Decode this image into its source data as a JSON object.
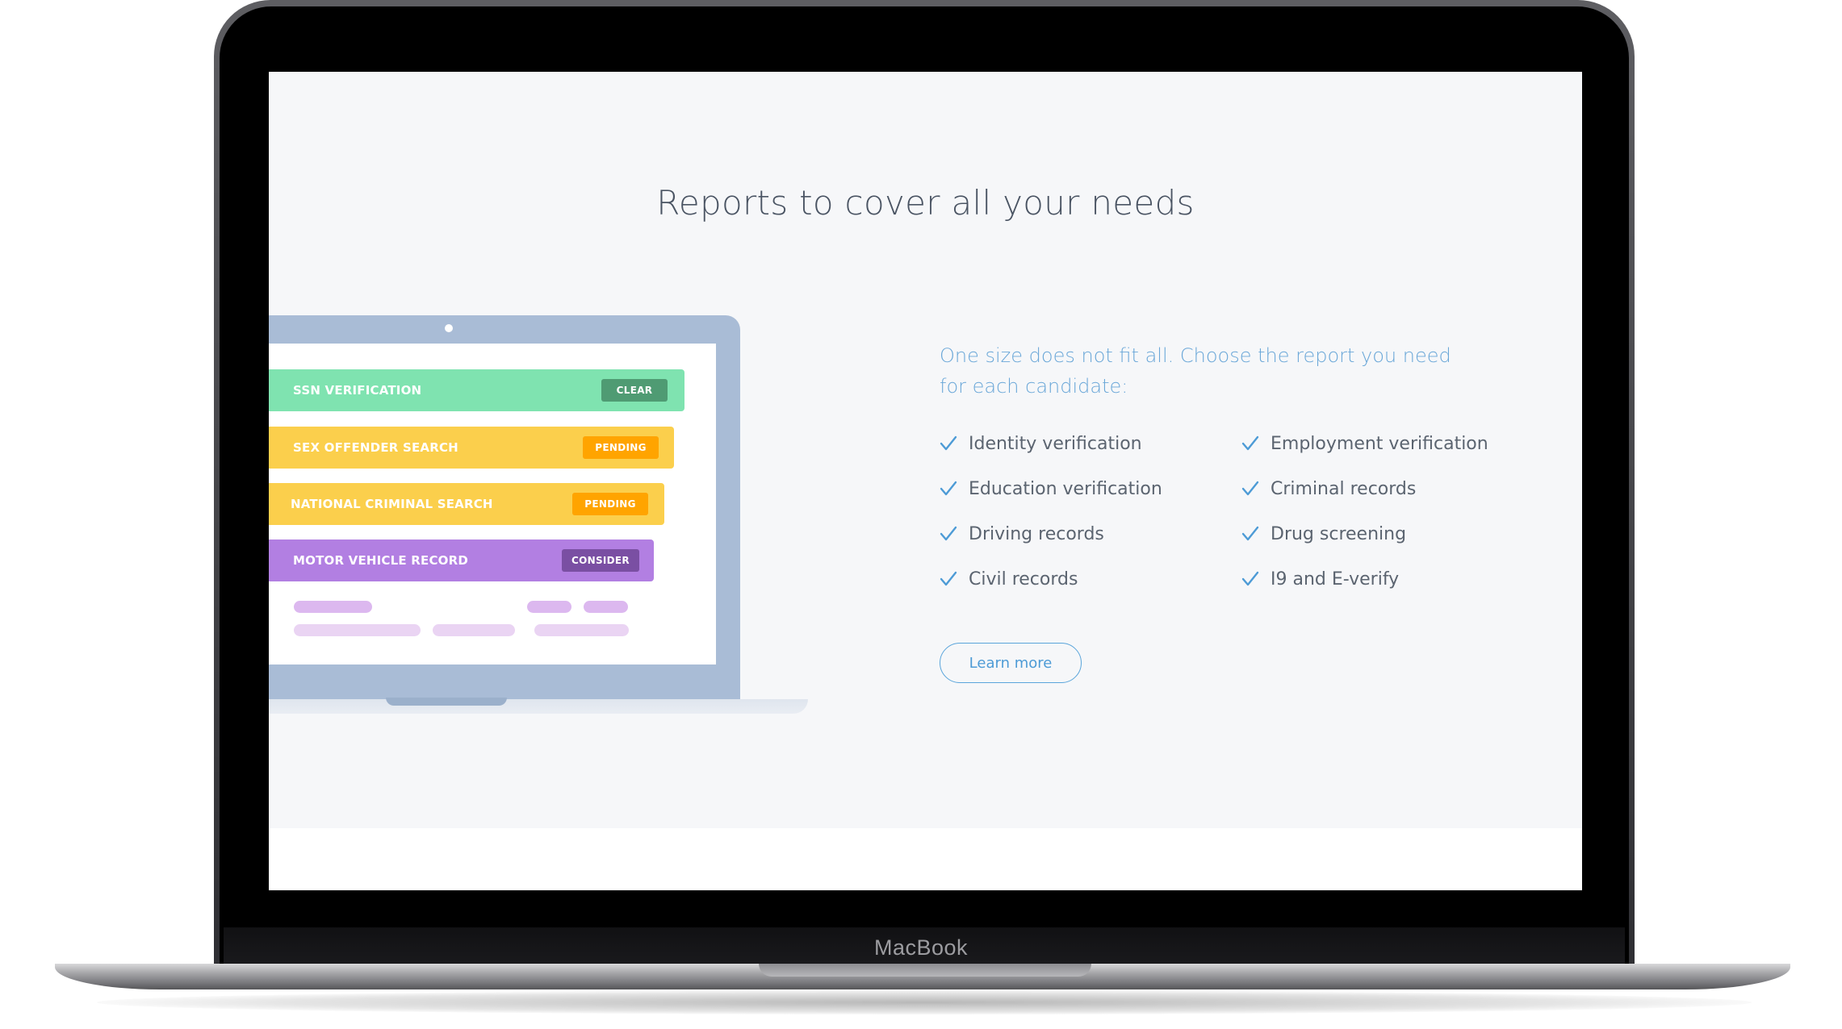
{
  "device": {
    "brand_label": "MacBook"
  },
  "section": {
    "title": "Reports to cover all your needs",
    "intro": "One size does not fit all. Choose the report you need for each candidate:",
    "features": [
      {
        "label": "Identity verification",
        "icon": "check-icon"
      },
      {
        "label": "Employment verification",
        "icon": "check-icon"
      },
      {
        "label": "Education verification",
        "icon": "check-icon"
      },
      {
        "label": "Criminal records",
        "icon": "check-icon"
      },
      {
        "label": "Driving records",
        "icon": "check-icon"
      },
      {
        "label": "Drug screening",
        "icon": "check-icon"
      },
      {
        "label": "Civil records",
        "icon": "check-icon"
      },
      {
        "label": "I9 and E-verify",
        "icon": "check-icon"
      }
    ],
    "learn_more_label": "Learn more"
  },
  "illustration": {
    "reports": [
      {
        "label": "SSN VERIFICATION",
        "status": "CLEAR",
        "color": "#7fe3b0",
        "status_color": "#4f9b73"
      },
      {
        "label": "SEX OFFENDER SEARCH",
        "status": "PENDING",
        "color": "#fbcf4c",
        "status_color": "#ffa400"
      },
      {
        "label": "NATIONAL CRIMINAL SEARCH",
        "status": "PENDING",
        "color": "#fbcf4c",
        "status_color": "#ffa400"
      },
      {
        "label": "MOTOR VEHICLE RECORD",
        "status": "CONSIDER",
        "color": "#b27fe2",
        "status_color": "#7a4fa3"
      }
    ]
  },
  "colors": {
    "accent": "#6aa7d8",
    "check": "#4d9bd6",
    "title": "#4a5463",
    "section_bg": "#f6f7f9"
  }
}
